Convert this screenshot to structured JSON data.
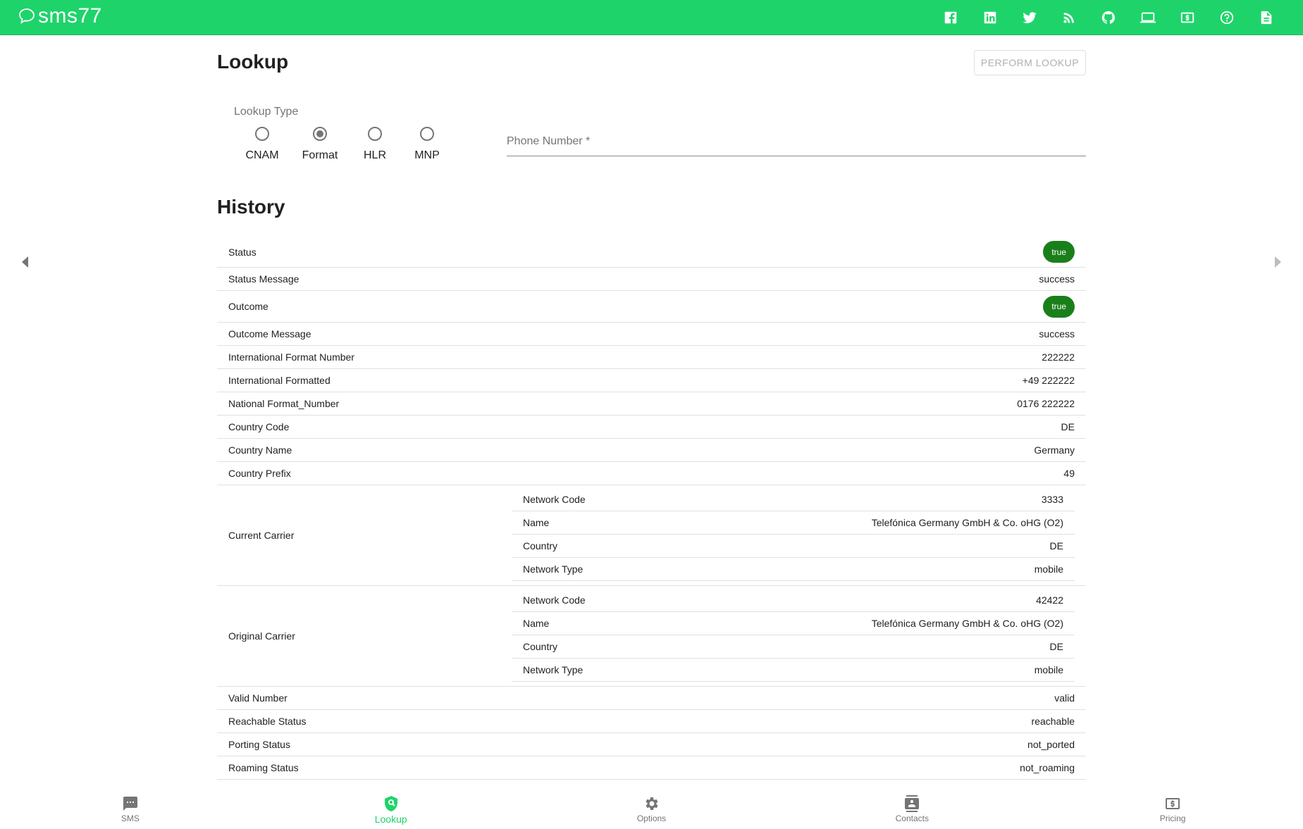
{
  "brand": {
    "name": "sms77"
  },
  "colors": {
    "primary": "#1ed46a",
    "badge": "#1a7f1a"
  },
  "top_icons": [
    "facebook-icon",
    "linkedin-icon",
    "twitter-icon",
    "rss-icon",
    "github-icon",
    "laptop-icon",
    "pricing-icon",
    "help-icon",
    "document-icon"
  ],
  "lookup": {
    "title": "Lookup",
    "perform_button": "PERFORM LOOKUP",
    "type_label": "Lookup Type",
    "types": [
      "CNAM",
      "Format",
      "HLR",
      "MNP"
    ],
    "selected_type": "Format",
    "phone_placeholder": "Phone Number *"
  },
  "history": {
    "title": "History",
    "rows": [
      {
        "label": "Status",
        "value": "true"
      },
      {
        "label": "Status Message",
        "value": "success"
      },
      {
        "label": "Outcome",
        "value": "true"
      },
      {
        "label": "Outcome Message",
        "value": "success"
      },
      {
        "label": "International Format Number",
        "value": "222222"
      },
      {
        "label": "International Formatted",
        "value": "+49 222222"
      },
      {
        "label": "National Format_Number",
        "value": "0176 222222"
      },
      {
        "label": "Country Code",
        "value": "DE"
      },
      {
        "label": "Country Name",
        "value": "Germany"
      },
      {
        "label": "Country Prefix",
        "value": "49"
      }
    ],
    "current_carrier": {
      "label": "Current Carrier",
      "fields": [
        {
          "label": "Network Code",
          "value": "3333"
        },
        {
          "label": "Name",
          "value": "Telefónica Germany GmbH & Co. oHG (O2)"
        },
        {
          "label": "Country",
          "value": "DE"
        },
        {
          "label": "Network Type",
          "value": "mobile"
        }
      ]
    },
    "original_carrier": {
      "label": "Original Carrier",
      "fields": [
        {
          "label": "Network Code",
          "value": "42422"
        },
        {
          "label": "Name",
          "value": "Telefónica Germany GmbH & Co. oHG (O2)"
        },
        {
          "label": "Country",
          "value": "DE"
        },
        {
          "label": "Network Type",
          "value": "mobile"
        }
      ]
    },
    "rows_after": [
      {
        "label": "Valid Number",
        "value": "valid"
      },
      {
        "label": "Reachable Status",
        "value": "reachable"
      },
      {
        "label": "Porting Status",
        "value": "not_ported"
      },
      {
        "label": "Roaming Status",
        "value": "not_roaming"
      }
    ]
  },
  "bottom_nav": [
    {
      "label": "SMS",
      "icon": "sms-icon"
    },
    {
      "label": "Lookup",
      "icon": "lookup-icon"
    },
    {
      "label": "Options",
      "icon": "gear-icon"
    },
    {
      "label": "Contacts",
      "icon": "contacts-icon"
    },
    {
      "label": "Pricing",
      "icon": "pricing-icon"
    }
  ],
  "bottom_nav_active": "Lookup"
}
